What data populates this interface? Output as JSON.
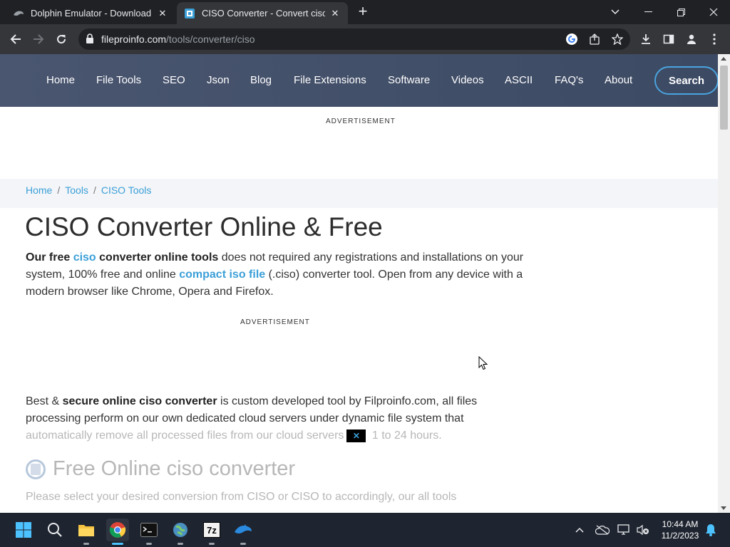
{
  "browser": {
    "tabs": [
      {
        "title": "Dolphin Emulator - Download",
        "icon": "dolphin-icon",
        "active": false
      },
      {
        "title": "CISO Converter - Convert ciso O",
        "icon": "fileproinfo-icon",
        "active": true
      }
    ],
    "url_host": "fileproinfo.com",
    "url_path": "/tools/converter/ciso"
  },
  "site_nav": {
    "items": [
      "Home",
      "File Tools",
      "SEO",
      "Json",
      "Blog",
      "File Extensions",
      "Software",
      "Videos",
      "ASCII",
      "FAQ's",
      "About"
    ],
    "search_label": "Search"
  },
  "ads": {
    "label_top": "ADVERTISEMENT",
    "label_mid": "ADVERTISEMENT"
  },
  "breadcrumb": [
    "Home",
    "Tools",
    "CISO Tools"
  ],
  "content": {
    "title": "CISO Converter Online & Free",
    "intro": {
      "p1_bold": "Our free ",
      "p1_link1": "ciso",
      "p1_bold2": " converter online tools",
      "p1_text": " does not required any registrations and installations on your system, 100% free and online ",
      "p1_link2": "compact iso file",
      "p1_text2": " (.ciso) converter tool. Open from any device with a modern browser like Chrome, Opera and Firefox."
    },
    "secure": {
      "p2_text1": "Best & ",
      "p2_bold": "secure online ciso converter",
      "p2_text2": " is custom developed tool by Filproinfo.com, all files processing perform on our own dedicated cloud servers under dynamic file system that ",
      "p2_faded1": "automatically remove all processed files from our cloud servers",
      "p2_badge": "✕",
      "p2_faded2": " 1 to 24 hours."
    },
    "sub_heading": "Free Online ciso converter",
    "select_text": "Please select your desired conversion from CISO or CISO to accordingly, our all tools"
  },
  "taskbar": {
    "apps": [
      "windows-start-icon",
      "search-icon",
      "file-explorer-icon",
      "chrome-icon",
      "terminal-icon",
      "network-globe-icon",
      "7zip-icon",
      "dolphin-icon"
    ],
    "app_label_7z": "7z",
    "time": "10:44 AM",
    "date": "11/2/2023"
  }
}
